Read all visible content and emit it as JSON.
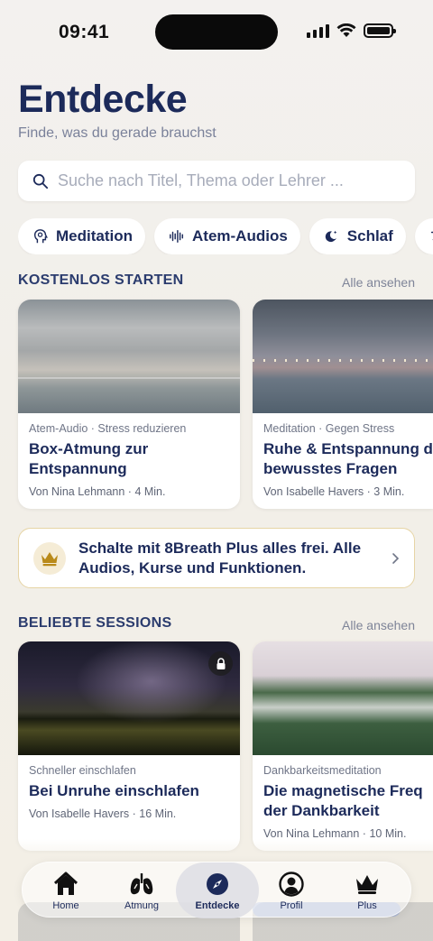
{
  "status_bar": {
    "time": "09:41"
  },
  "header": {
    "title": "Entdecke",
    "subtitle": "Finde, was du gerade brauchst"
  },
  "search": {
    "placeholder": "Suche nach Titel, Thema oder Lehrer ..."
  },
  "chips": [
    {
      "label": "Meditation",
      "icon": "head-icon"
    },
    {
      "label": "Atem-Audios",
      "icon": "waveform-icon"
    },
    {
      "label": "Schlaf",
      "icon": "moon-icon"
    },
    {
      "label": "",
      "icon": "yoga-icon"
    }
  ],
  "free_section": {
    "title": "KOSTENLOS STARTEN",
    "link": "Alle ansehen",
    "cards": [
      {
        "meta": "Atem-Audio · Stress reduzieren",
        "title_line1": "Box-Atmung zur",
        "title_line2": "Entspannung",
        "byline": "Von Nina Lehmann · 4 Min."
      },
      {
        "meta": "Meditation · Gegen Stress",
        "title_line1": "Ruhe & Entspannung d",
        "title_line2": "bewusstes Fragen",
        "byline": "Von Isabelle Havers · 3 Min."
      }
    ]
  },
  "banner": {
    "text": "Schalte mit 8Breath Plus alles frei. Alle Audios, Kurse und Funktionen.",
    "accent": "#e6d4a4"
  },
  "popular_section": {
    "title": "BELIEBTE SESSIONS",
    "link": "Alle ansehen",
    "cards": [
      {
        "meta": "Schneller einschlafen",
        "title_line1": "Bei Unruhe einschlafen",
        "title_line2": "",
        "byline": "Von Isabelle Havers · 16 Min.",
        "locked": true
      },
      {
        "meta": "Dankbarkeitsmeditation",
        "title_line1": "Die magnetische Freq",
        "title_line2": "der Dankbarkeit",
        "byline": "Von Nina Lehmann · 10 Min.",
        "locked": false
      }
    ]
  },
  "tabbar": {
    "tabs": [
      {
        "label": "Home",
        "icon": "home-icon"
      },
      {
        "label": "Atmung",
        "icon": "lungs-icon"
      },
      {
        "label": "Entdecke",
        "icon": "compass-icon",
        "active": true
      },
      {
        "label": "Profil",
        "icon": "profile-icon"
      },
      {
        "label": "Plus",
        "icon": "crown-icon"
      }
    ]
  },
  "colors": {
    "primary": "#1c2a5a",
    "muted": "#7a819a",
    "gold": "#b98a1a"
  }
}
